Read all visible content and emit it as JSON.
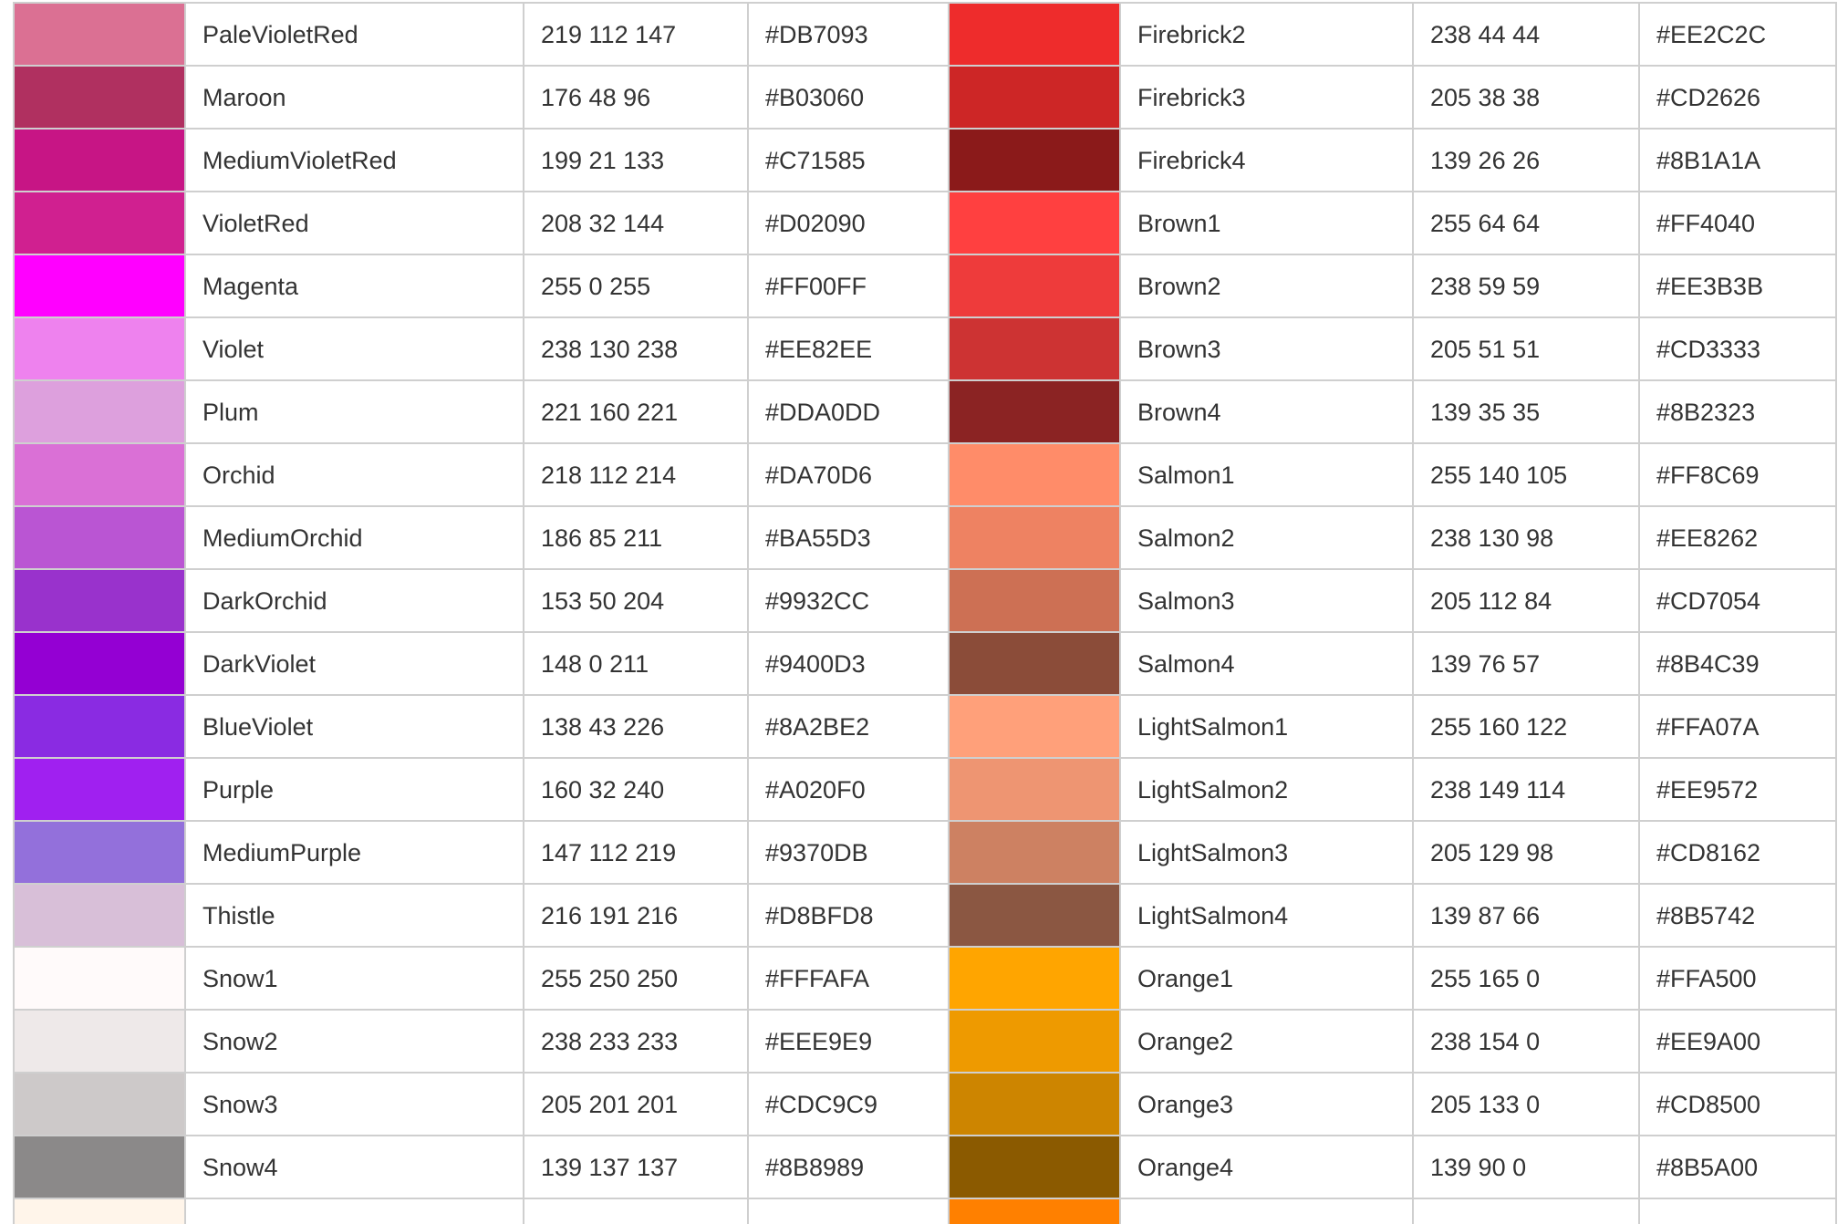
{
  "rows": [
    [
      {
        "name": "PaleVioletRed",
        "rgb": "219 112 147",
        "hex": "#DB7093"
      },
      {
        "name": "Firebrick2",
        "rgb": "238 44 44",
        "hex": "#EE2C2C"
      }
    ],
    [
      {
        "name": "Maroon",
        "rgb": "176 48 96",
        "hex": "#B03060"
      },
      {
        "name": "Firebrick3",
        "rgb": "205 38 38",
        "hex": "#CD2626"
      }
    ],
    [
      {
        "name": "MediumVioletRed",
        "rgb": "199 21 133",
        "hex": "#C71585"
      },
      {
        "name": "Firebrick4",
        "rgb": "139 26 26",
        "hex": "#8B1A1A"
      }
    ],
    [
      {
        "name": "VioletRed",
        "rgb": "208 32 144",
        "hex": "#D02090"
      },
      {
        "name": "Brown1",
        "rgb": "255 64 64",
        "hex": "#FF4040"
      }
    ],
    [
      {
        "name": "Magenta",
        "rgb": "255 0 255",
        "hex": "#FF00FF"
      },
      {
        "name": "Brown2",
        "rgb": "238 59 59",
        "hex": "#EE3B3B"
      }
    ],
    [
      {
        "name": "Violet",
        "rgb": "238 130 238",
        "hex": "#EE82EE"
      },
      {
        "name": "Brown3",
        "rgb": "205 51 51",
        "hex": "#CD3333"
      }
    ],
    [
      {
        "name": "Plum",
        "rgb": "221 160 221",
        "hex": "#DDA0DD"
      },
      {
        "name": "Brown4",
        "rgb": "139 35 35",
        "hex": "#8B2323"
      }
    ],
    [
      {
        "name": "Orchid",
        "rgb": "218 112 214",
        "hex": "#DA70D6"
      },
      {
        "name": "Salmon1",
        "rgb": "255 140 105",
        "hex": "#FF8C69"
      }
    ],
    [
      {
        "name": "MediumOrchid",
        "rgb": "186 85 211",
        "hex": "#BA55D3"
      },
      {
        "name": "Salmon2",
        "rgb": "238 130 98",
        "hex": "#EE8262"
      }
    ],
    [
      {
        "name": "DarkOrchid",
        "rgb": "153 50 204",
        "hex": "#9932CC"
      },
      {
        "name": "Salmon3",
        "rgb": "205 112 84",
        "hex": "#CD7054"
      }
    ],
    [
      {
        "name": "DarkViolet",
        "rgb": "148 0 211",
        "hex": "#9400D3"
      },
      {
        "name": "Salmon4",
        "rgb": "139 76 57",
        "hex": "#8B4C39"
      }
    ],
    [
      {
        "name": "BlueViolet",
        "rgb": "138 43 226",
        "hex": "#8A2BE2"
      },
      {
        "name": "LightSalmon1",
        "rgb": "255 160 122",
        "hex": "#FFA07A"
      }
    ],
    [
      {
        "name": "Purple",
        "rgb": "160 32 240",
        "hex": "#A020F0"
      },
      {
        "name": "LightSalmon2",
        "rgb": "238 149 114",
        "hex": "#EE9572"
      }
    ],
    [
      {
        "name": "MediumPurple",
        "rgb": "147 112 219",
        "hex": "#9370DB"
      },
      {
        "name": "LightSalmon3",
        "rgb": "205 129 98",
        "hex": "#CD8162"
      }
    ],
    [
      {
        "name": "Thistle",
        "rgb": "216 191 216",
        "hex": "#D8BFD8"
      },
      {
        "name": "LightSalmon4",
        "rgb": "139 87 66",
        "hex": "#8B5742"
      }
    ],
    [
      {
        "name": "Snow1",
        "rgb": "255 250 250",
        "hex": "#FFFAFA"
      },
      {
        "name": "Orange1",
        "rgb": "255 165 0",
        "hex": "#FFA500"
      }
    ],
    [
      {
        "name": "Snow2",
        "rgb": "238 233 233",
        "hex": "#EEE9E9"
      },
      {
        "name": "Orange2",
        "rgb": "238 154 0",
        "hex": "#EE9A00"
      }
    ],
    [
      {
        "name": "Snow3",
        "rgb": "205 201 201",
        "hex": "#CDC9C9"
      },
      {
        "name": "Orange3",
        "rgb": "205 133 0",
        "hex": "#CD8500"
      }
    ],
    [
      {
        "name": "Snow4",
        "rgb": "139 137 137",
        "hex": "#8B8989"
      },
      {
        "name": "Orange4",
        "rgb": "139 90 0",
        "hex": "#8B5A00"
      }
    ]
  ],
  "partial_row_swatches": [
    "#FFF5EA",
    "#FF8000"
  ]
}
